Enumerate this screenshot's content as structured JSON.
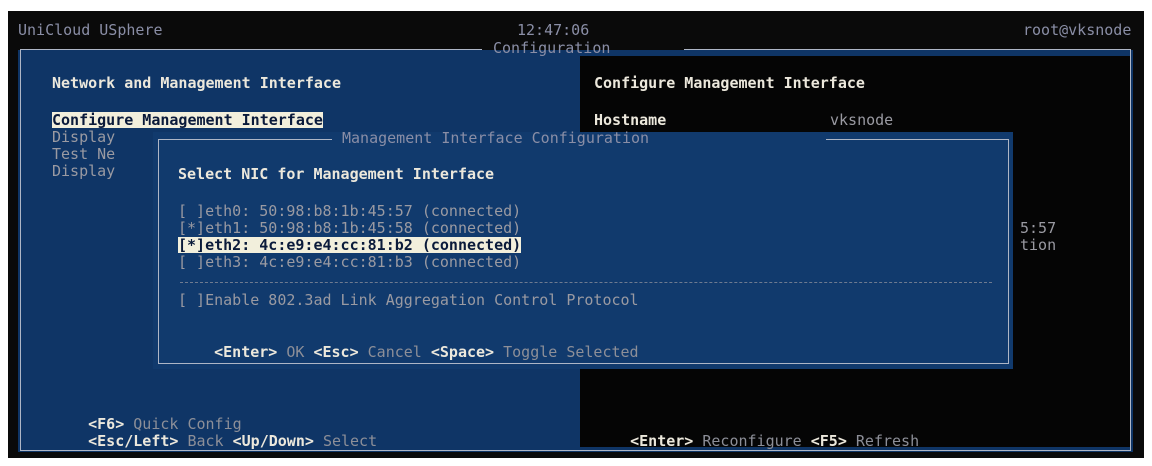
{
  "title_bar": {
    "app_name": "UniCloud USphere",
    "time": "12:47:06",
    "user_host": "root@vksnode"
  },
  "main_window": {
    "title": "Configuration",
    "left_panel": {
      "heading": "Network and Management Interface",
      "menu_items": [
        "Configure Management Interface",
        "Display",
        "Test Ne",
        "Display"
      ],
      "footer_line1": {
        "key": "<F6>",
        "action": "Quick Config"
      },
      "footer_line2": {
        "key1": "<Esc/Left>",
        "action1": "Back",
        "key2": "<Up/Down>",
        "action2": "Select"
      }
    },
    "right_panel": {
      "heading": "Configure Management Interface",
      "hostname_label": "Hostname",
      "hostname_value": "vksnode",
      "partial_line1": "5:57",
      "partial_line2": "tion",
      "footer": {
        "key1": "<Enter>",
        "action1": "Reconfigure",
        "key2": "<F5>",
        "action2": "Refresh"
      }
    }
  },
  "dialog": {
    "title": "Management Interface Configuration",
    "prompt": "Select NIC for Management Interface",
    "nics": [
      {
        "text": "[ ]eth0: 50:98:b8:1b:45:57 (connected)",
        "selected": false,
        "focused": false
      },
      {
        "text": "[*]eth1: 50:98:b8:1b:45:58 (connected)",
        "selected": true,
        "focused": false
      },
      {
        "text": "[*]eth2: 4c:e9:e4:cc:81:b2 (connected)",
        "selected": true,
        "focused": true
      },
      {
        "text": "[ ]eth3: 4c:e9:e4:cc:81:b3 (connected)",
        "selected": false,
        "focused": false
      }
    ],
    "lacp_option": "[ ]Enable 802.3ad Link Aggregation Control Protocol",
    "footer": {
      "key1": "<Enter>",
      "action1": "OK",
      "key2": "<Esc>",
      "action2": "Cancel",
      "key3": "<Space>",
      "action3": "Toggle Selected"
    }
  },
  "colors": {
    "background": "#0a0a0a",
    "panel_blue": "#0f3566",
    "highlight": "#f2efdc",
    "text_bright": "#ece8dc",
    "text_dim": "#9a9aa2"
  }
}
